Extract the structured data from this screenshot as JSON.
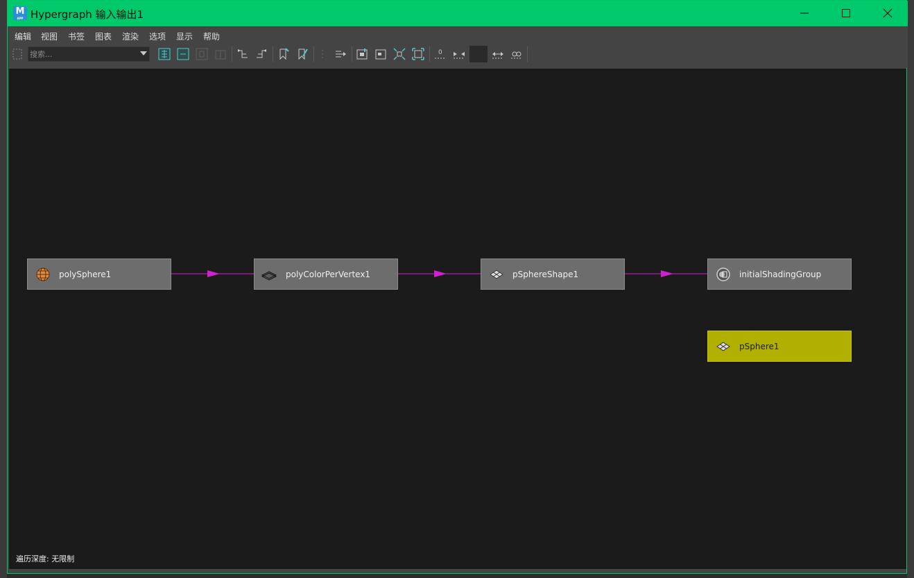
{
  "window": {
    "title": "Hypergraph 输入输出1",
    "app_icon_letter": "M",
    "app_icon_sub": "APP",
    "accent_color": "#00c96b"
  },
  "menu": {
    "items": [
      "编辑",
      "视图",
      "书签",
      "图表",
      "渲染",
      "选项",
      "显示",
      "帮助"
    ]
  },
  "toolbar": {
    "search_placeholder": "搜索...",
    "buttons": [
      "scene-hierarchy",
      "input-output-connections",
      "freeform-mode",
      "grid-mode",
      "show-upstream",
      "show-downstream",
      "add-bookmark",
      "edit-bookmark",
      "layout-vertical",
      "layout-horizontal",
      "frame-graph",
      "frame-selection",
      "frame-hierarchy",
      "frame-branch",
      "clear-graph",
      "collapse",
      "color-swatch",
      "expand",
      "rebuild"
    ]
  },
  "graph": {
    "nodes": [
      {
        "id": "polySphere1",
        "label": "polySphere1",
        "icon": "poly-sphere-icon",
        "selected": false
      },
      {
        "id": "polyColorPerVertex1",
        "label": "polyColorPerVertex1",
        "icon": "poly-plane-icon",
        "selected": false
      },
      {
        "id": "pSphereShape1",
        "label": "pSphereShape1",
        "icon": "mesh-shape-icon",
        "selected": false
      },
      {
        "id": "initialShadingGroup",
        "label": "initialShadingGroup",
        "icon": "shading-group-icon",
        "selected": false
      },
      {
        "id": "pSphere1",
        "label": "pSphere1",
        "icon": "mesh-shape-icon",
        "selected": true
      }
    ],
    "connections": [
      {
        "from": "polySphere1",
        "to": "polyColorPerVertex1"
      },
      {
        "from": "polyColorPerVertex1",
        "to": "pSphereShape1"
      },
      {
        "from": "pSphereShape1",
        "to": "initialShadingGroup"
      }
    ],
    "connection_color": "#d020d0",
    "selected_color": "#b1b000"
  },
  "status": {
    "traversal_depth": "遍历深度: 无限制"
  }
}
